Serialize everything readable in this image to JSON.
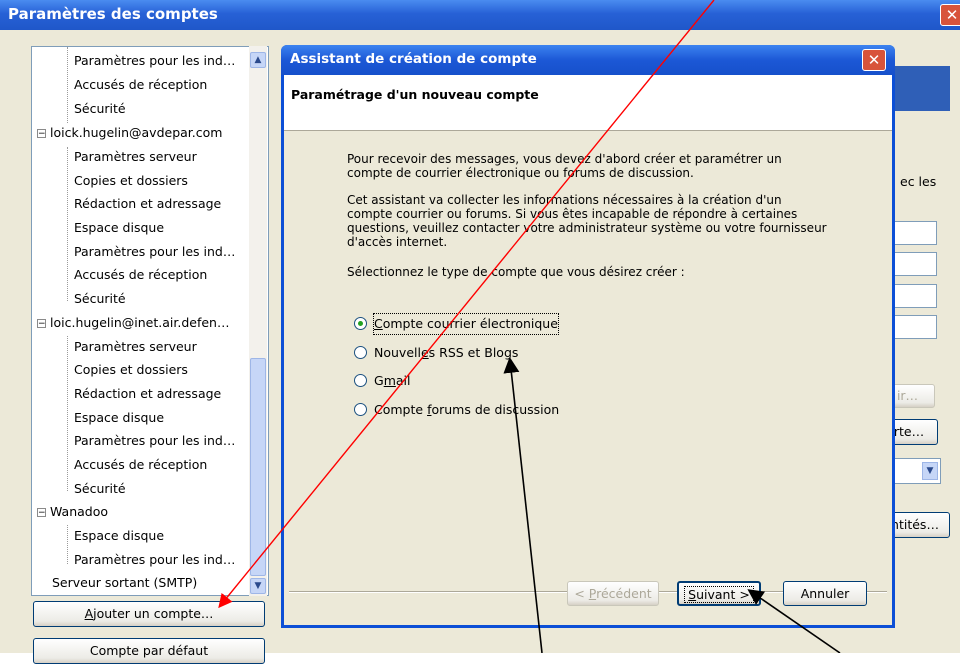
{
  "main_window": {
    "title": "Paramètres des comptes",
    "close_glyph": "✕"
  },
  "tree": {
    "group1": [
      "Paramètres pour les ind…",
      "Accusés de réception",
      "Sécurité"
    ],
    "account2": {
      "name": "loick.hugelin@avdepar.com",
      "items": [
        "Paramètres serveur",
        "Copies et dossiers",
        "Rédaction et adressage",
        "Espace disque",
        "Paramètres pour les ind…",
        "Accusés de réception",
        "Sécurité"
      ]
    },
    "account3": {
      "name": "loic.hugelin@inet.air.defen…",
      "items": [
        "Paramètres serveur",
        "Copies et dossiers",
        "Rédaction et adressage",
        "Espace disque",
        "Paramètres pour les ind…",
        "Accusés de réception",
        "Sécurité"
      ]
    },
    "account4": {
      "name": "Wanadoo",
      "items": [
        "Espace disque",
        "Paramètres pour les ind…"
      ]
    },
    "smtp": "Serveur sortant (SMTP)",
    "expander_glyph": "−"
  },
  "buttons": {
    "add_account_pre": "",
    "add_account_key": "A",
    "add_account_post": "jouter un compte…",
    "default_account": "Compte par défaut"
  },
  "right_partial": {
    "text1": "ec les",
    "btn1": "ir…",
    "btn2": "rte…",
    "btn3": "ntités…"
  },
  "dialog": {
    "title": "Assistant de création de compte",
    "close_glyph": "✕",
    "header": "Paramétrage d'un nouveau compte",
    "para1": "Pour recevoir des messages, vous devez d'abord créer et paramétrer un compte de courrier électronique ou forums de discussion.",
    "para2": "Cet assistant va collecter les informations nécessaires à la création d'un compte courrier ou forums. Si vous êtes incapable de répondre à certaines questions, veuillez contacter votre administrateur système ou votre fournisseur d'accès internet.",
    "para3": "Sélectionnez le type de compte que vous désirez créer :",
    "options": [
      {
        "key": "C",
        "rest": "ompte courrier électronique",
        "selected": true
      },
      {
        "pre": "Nouvell",
        "key": "e",
        "rest": "s RSS et Blogs",
        "selected": false
      },
      {
        "pre": "G",
        "key": "m",
        "rest": "ail",
        "selected": false
      },
      {
        "pre": "Compte ",
        "key": "f",
        "rest": "orums de discussion",
        "selected": false
      }
    ],
    "btn_prev_pre": "< ",
    "btn_prev_key": "P",
    "btn_prev_rest": "récédent",
    "btn_next_key": "S",
    "btn_next_rest": "uivant >",
    "btn_cancel": "Annuler"
  },
  "colors": {
    "annotation_red": "#ff0000",
    "annotation_black": "#000000",
    "titlebar_blue": "#0c4fd6"
  }
}
